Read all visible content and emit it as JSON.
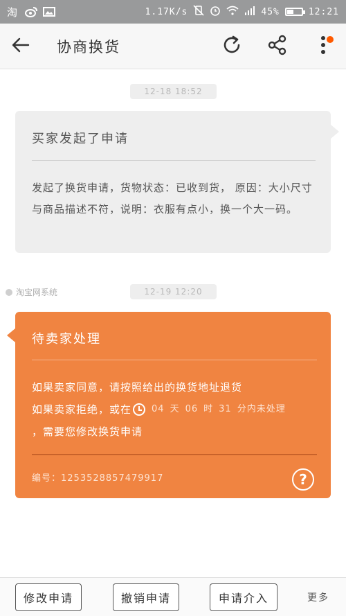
{
  "status_bar": {
    "left_icons": [
      "taobao-icon",
      "weibo-icon",
      "image-icon"
    ],
    "network_speed": "1.17K/s",
    "battery": "45%",
    "battery_level": 0.45,
    "time": "12:21"
  },
  "app_bar": {
    "title": "协商换货",
    "badge_color": "#ff5a00"
  },
  "messages": {
    "first": {
      "timestamp": "12-18 18:52",
      "title": "买家发起了申请",
      "body": "发起了换货申请，货物状态：已收到货，  原因：大小尺寸与商品描述不符，说明：衣服有点小，换一个大一码。"
    },
    "second": {
      "timestamp": "12-19 12:20",
      "sender": "淘宝网系统",
      "title": "待卖家处理",
      "line1": "如果卖家同意，请按照给出的换货地址退货",
      "line2_prefix": "如果卖家拒绝，或在",
      "countdown": {
        "days": "04",
        "days_label": "天",
        "hours": "06",
        "hours_label": "时",
        "minutes": "31",
        "minutes_label": "分内未处理"
      },
      "line3": "，需要您修改换货申请",
      "code_label": "编号：",
      "code": "1253528857479917",
      "accent_color": "#f08441"
    }
  },
  "bottom_bar": {
    "btn_modify": "修改申请",
    "btn_cancel": "撤销申请",
    "btn_intervene": "申请介入",
    "more": "更多"
  }
}
